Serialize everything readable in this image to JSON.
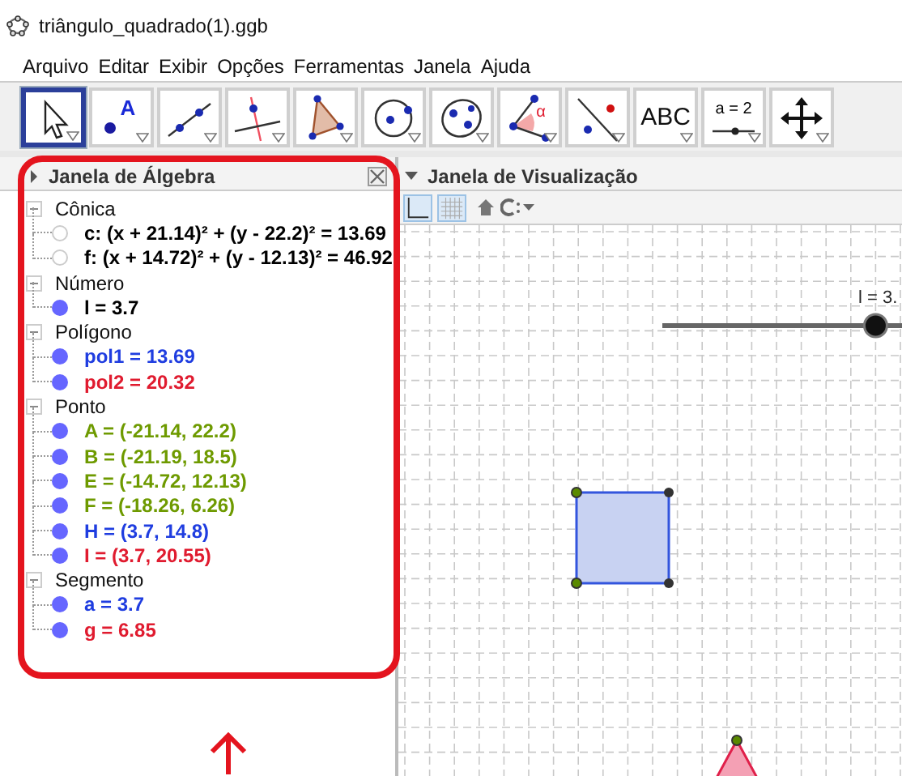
{
  "window": {
    "title": "triângulo_quadrado(1).ggb"
  },
  "menu": [
    "Arquivo",
    "Editar",
    "Exibir",
    "Opções",
    "Ferramentas",
    "Janela",
    "Ajuda"
  ],
  "tools": [
    {
      "kind": "move",
      "selected": true
    },
    {
      "kind": "point",
      "label": "A",
      "selected": false
    },
    {
      "kind": "line",
      "selected": false
    },
    {
      "kind": "perpendicular",
      "selected": false
    },
    {
      "kind": "polygon",
      "selected": false
    },
    {
      "kind": "circle",
      "selected": false
    },
    {
      "kind": "ellipse",
      "selected": false
    },
    {
      "kind": "angle",
      "label": "α",
      "selected": false
    },
    {
      "kind": "reflect",
      "selected": false
    },
    {
      "kind": "text",
      "label": "ABC",
      "selected": false
    },
    {
      "kind": "slider",
      "label": "a = 2",
      "selected": false
    },
    {
      "kind": "move-view",
      "selected": false
    }
  ],
  "algebra": {
    "title": "Janela de Álgebra",
    "groups": [
      {
        "name": "Cônica",
        "expanded": true,
        "children": [
          {
            "text": "c: (x + 21.14)² + (y - 22.2)² = 13.69",
            "color": "#000000",
            "shown": false
          },
          {
            "text": "f: (x + 14.72)² + (y - 12.13)² = 46.92",
            "color": "#000000",
            "shown": false
          }
        ]
      },
      {
        "name": "Número",
        "expanded": true,
        "children": [
          {
            "text": "l = 3.7",
            "color": "#000000",
            "shown": true
          }
        ]
      },
      {
        "name": "Polígono",
        "expanded": true,
        "children": [
          {
            "text": "pol1 = 13.69",
            "color": "#1f3de0",
            "shown": true
          },
          {
            "text": "pol2 = 20.32",
            "color": "#e01b2f",
            "shown": true
          }
        ]
      },
      {
        "name": "Ponto",
        "expanded": true,
        "children": [
          {
            "text": "A = (-21.14, 22.2)",
            "color": "#6e9a00",
            "shown": true
          },
          {
            "text": "B = (-21.19, 18.5)",
            "color": "#6e9a00",
            "shown": true
          },
          {
            "text": "E = (-14.72, 12.13)",
            "color": "#6e9a00",
            "shown": true
          },
          {
            "text": "F = (-18.26, 6.26)",
            "color": "#6e9a00",
            "shown": true
          },
          {
            "text": "H = (3.7, 14.8)",
            "color": "#1f3de0",
            "shown": true
          },
          {
            "text": "I = (3.7, 20.55)",
            "color": "#e01b2f",
            "shown": true
          }
        ]
      },
      {
        "name": "Segmento",
        "expanded": true,
        "children": [
          {
            "text": "a = 3.7",
            "color": "#1f3de0",
            "shown": true
          },
          {
            "text": "g = 6.85",
            "color": "#e01b2f",
            "shown": true
          }
        ]
      }
    ]
  },
  "graphics": {
    "title": "Janela de Visualização",
    "axes_on": true,
    "grid_on": true,
    "slider": {
      "label": "l = 3.",
      "level": 0.89
    }
  }
}
